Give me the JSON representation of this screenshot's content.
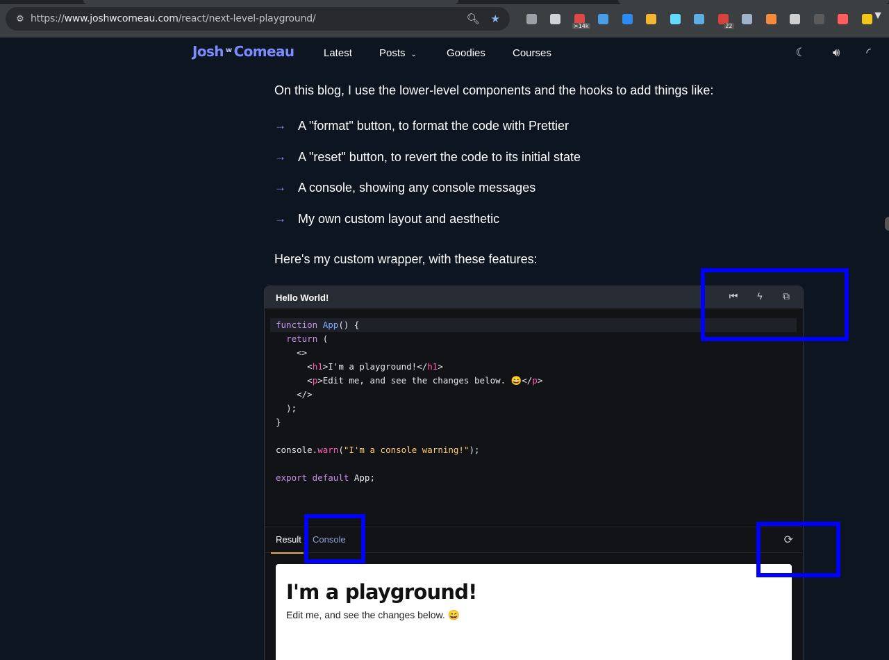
{
  "browser": {
    "url_prefix": "https://",
    "url_host": "www.joshwcomeau.com",
    "url_path": "/react/next-level-playground/",
    "extensions": [
      {
        "name": "mic-icon",
        "color": "#9aa0a6"
      },
      {
        "name": "camera-icon",
        "color": "#cfd2d6"
      },
      {
        "name": "calendar-ext-icon",
        "color": "#e04848",
        "badge": ">14k"
      },
      {
        "name": "window-ext-icon",
        "color": "#4a9be8"
      },
      {
        "name": "trello-ext-icon",
        "color": "#2b8bf0"
      },
      {
        "name": "heart-ext-icon",
        "color": "#f2b632"
      },
      {
        "name": "react-devtools-icon",
        "color": "#61dafb"
      },
      {
        "name": "image-ext-icon",
        "color": "#5dade2"
      },
      {
        "name": "red-ext-icon",
        "color": "#d9413b",
        "badge": "22"
      },
      {
        "name": "glasses-ext-icon",
        "color": "#9fb3c8"
      },
      {
        "name": "flag-ext-icon",
        "color": "#f48b3c"
      },
      {
        "name": "cube-ext-icon",
        "color": "#cfcfcf"
      },
      {
        "name": "bug-ext-icon",
        "color": "#5a5a5a"
      },
      {
        "name": "arrow-ext-icon",
        "color": "#ff5c5c"
      },
      {
        "name": "pencil-ext-icon",
        "color": "#f0c419"
      }
    ]
  },
  "header": {
    "logo_left": "Josh",
    "logo_mid": "w",
    "logo_right": "Comeau",
    "nav": {
      "latest": "Latest",
      "posts": "Posts",
      "goodies": "Goodies",
      "courses": "Courses"
    }
  },
  "article": {
    "intro": "On this blog, I use the lower-level components and the hooks to add things like:",
    "bullets": [
      "A \"format\" button, to format the code with Prettier",
      "A \"reset\" button, to revert the code to its initial state",
      "A console, showing any console messages",
      "My own custom layout and aesthetic"
    ],
    "wrapper_intro": "Here's my custom wrapper, with these features:"
  },
  "playground": {
    "title": "Hello World!",
    "tabs": {
      "result": "Result",
      "console": "Console"
    },
    "preview": {
      "heading": "I'm a playground!",
      "text": "Edit me, and see the changes below. 😄"
    }
  },
  "code": {
    "l1_kw": "function",
    "l1_fn": "App",
    "l1_rest": "() {",
    "l2_kw": "return",
    "l2_rest": " (",
    "l3": "<>",
    "l4_open": "<",
    "l4_tag": "h1",
    "l4_mid": ">I'm a playground!</",
    "l4_tag2": "h1",
    "l4_close": ">",
    "l5_open": "<",
    "l5_tag": "p",
    "l5_mid": ">Edit me, and see the changes below. 😄</",
    "l5_tag2": "p",
    "l5_close": ">",
    "l6": "</>",
    "l7": ");",
    "l8": "}",
    "l10_obj": "console.",
    "l10_fn": "warn",
    "l10_str": "\"I'm a console warning!\"",
    "l10_rest": ");",
    "l12_kw": "export default",
    "l12_rest": " App;"
  }
}
